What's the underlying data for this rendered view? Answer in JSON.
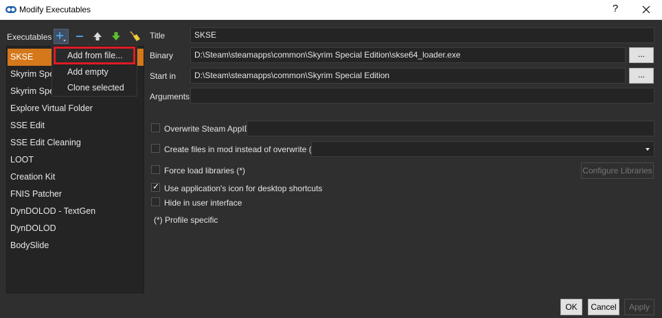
{
  "window": {
    "title": "Modify Executables",
    "help_label": "?"
  },
  "sidebar": {
    "label": "Executables",
    "items": [
      {
        "label": "SKSE",
        "selected": true
      },
      {
        "label": "Skyrim Special Edition"
      },
      {
        "label": "Skyrim Special Edition Launcher"
      },
      {
        "label": "Explore Virtual Folder"
      },
      {
        "label": "SSE Edit"
      },
      {
        "label": "SSE Edit Cleaning"
      },
      {
        "label": "LOOT"
      },
      {
        "label": "Creation Kit"
      },
      {
        "label": "FNIS Patcher"
      },
      {
        "label": "DynDOLOD - TextGen"
      },
      {
        "label": "DynDOLOD"
      },
      {
        "label": "BodySlide"
      }
    ]
  },
  "add_menu": {
    "items": [
      "Add from file...",
      "Add empty",
      "Clone selected"
    ]
  },
  "form": {
    "title_label": "Title",
    "title_value": "SKSE",
    "binary_label": "Binary",
    "binary_value": "D:\\Steam\\steamapps\\common\\Skyrim Special Edition\\skse64_loader.exe",
    "browse_label": "...",
    "startin_label": "Start in",
    "startin_value": "D:\\Steam\\steamapps\\common\\Skyrim Special Edition",
    "arguments_label": "Arguments",
    "arguments_value": "",
    "overwrite_appid_label": "Overwrite Steam AppID",
    "overwrite_appid_checked": false,
    "create_files_label": "Create files in mod instead of overwrite (*)",
    "create_files_checked": false,
    "force_load_label": "Force load libraries (*)",
    "force_load_checked": false,
    "configure_libraries_label": "Configure Libraries",
    "use_icon_label": "Use application's icon for desktop shortcuts",
    "use_icon_checked": true,
    "hide_ui_label": "Hide in user interface",
    "hide_ui_checked": false,
    "profile_note": "(*) Profile specific"
  },
  "footer": {
    "ok_label": "OK",
    "cancel_label": "Cancel",
    "apply_label": "Apply"
  },
  "colors": {
    "accent": "#d5781b",
    "highlight_border": "#e01b24",
    "background": "#2f2f2f"
  }
}
